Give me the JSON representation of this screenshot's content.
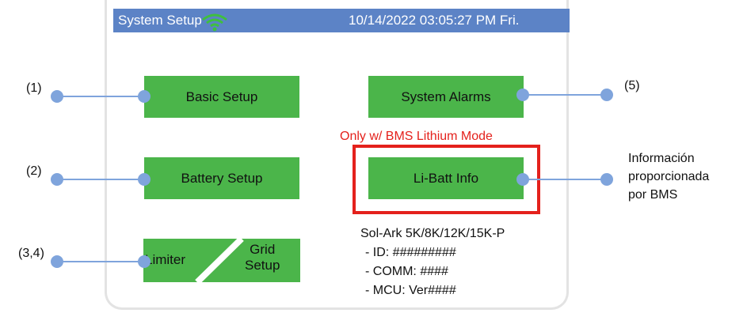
{
  "header": {
    "title": "System Setup",
    "wifi_icon": "wifi-icon",
    "datetime": "10/14/2022 03:05:27 PM  Fri."
  },
  "buttons": {
    "basic_setup": "Basic Setup",
    "system_alarms": "System Alarms",
    "battery_setup": "Battery Setup",
    "li_batt_info": "Li-Batt Info",
    "limiter": "Limiter",
    "grid_setup_line1": "Grid",
    "grid_setup_line2": "Setup"
  },
  "notes": {
    "bms_mode": "Only w/ BMS Lithium Mode",
    "bms_info_line1": "Información",
    "bms_info_line2": "proporcionada",
    "bms_info_line3": "por BMS"
  },
  "callouts": {
    "c1": "(1)",
    "c2": "(2)",
    "c34": "(3,4)",
    "c5": "(5)"
  },
  "device_info": {
    "model": "Sol-Ark 5K/8K/12K/15K-P",
    "id": "- ID: #########",
    "comm": "- COMM: ####",
    "mcu": "- MCU: Ver####"
  },
  "colors": {
    "header_bg": "#5c83c6",
    "button_green": "#4bb54a",
    "highlight_red": "#e4211c",
    "callout_blue": "#7fa4dc"
  }
}
